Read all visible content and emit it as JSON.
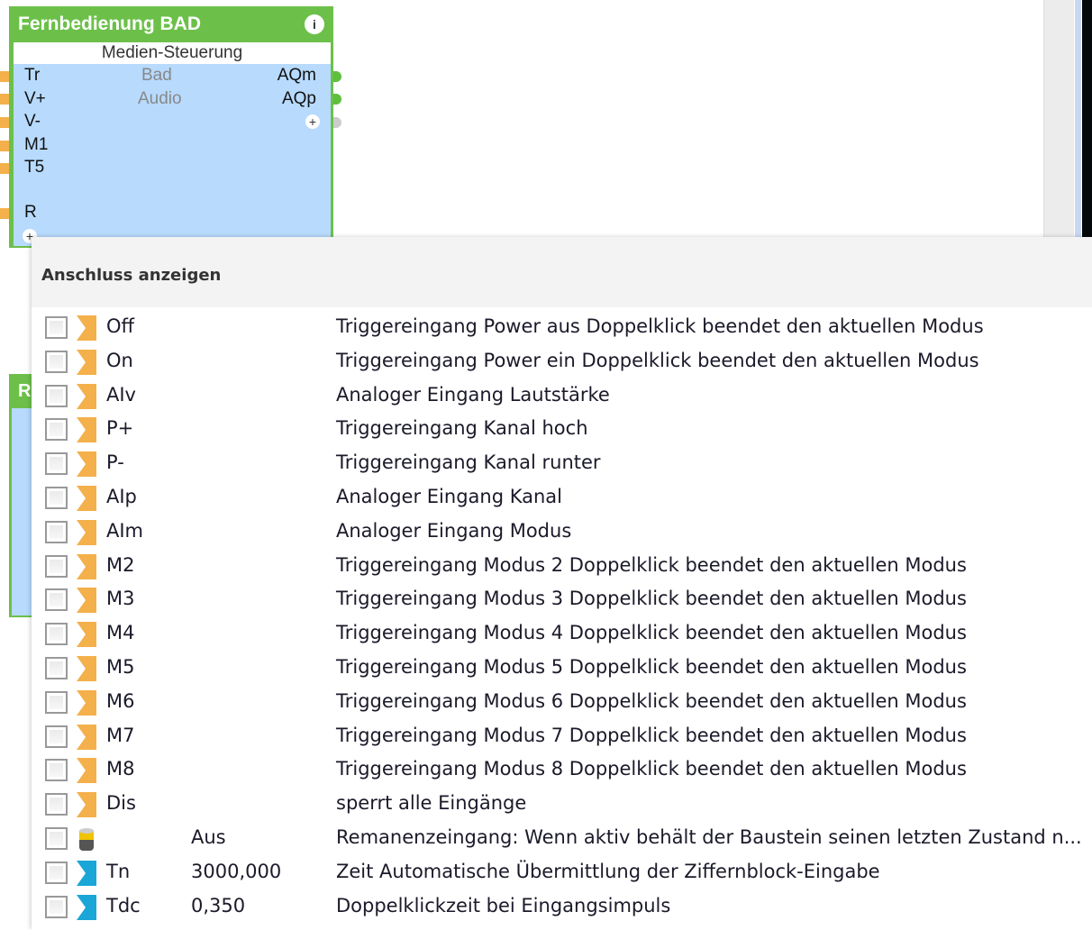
{
  "block": {
    "title": "Fernbedienung BAD",
    "subtitle": "Medien-Steuerung",
    "inputs": [
      "Tr",
      "V+",
      "V-",
      "M1",
      "T5",
      "R"
    ],
    "labels": [
      "Bad",
      "Audio"
    ],
    "outputs": [
      "AQm",
      "AQp"
    ],
    "block2_title": "R"
  },
  "popup": {
    "title": "Anschluss anzeigen",
    "rows": [
      {
        "icon": "trigger-input-icon",
        "name": "Off",
        "value": "",
        "desc": "Triggereingang Power aus Doppelklick beendet den aktuellen Modus"
      },
      {
        "icon": "trigger-input-icon",
        "name": "On",
        "value": "",
        "desc": "Triggereingang Power ein Doppelklick beendet den aktuellen Modus"
      },
      {
        "icon": "trigger-input-icon",
        "name": "AIv",
        "value": "",
        "desc": "Analoger Eingang Lautstärke"
      },
      {
        "icon": "trigger-input-icon",
        "name": "P+",
        "value": "",
        "desc": "Triggereingang Kanal hoch"
      },
      {
        "icon": "trigger-input-icon",
        "name": "P-",
        "value": "",
        "desc": "Triggereingang Kanal runter"
      },
      {
        "icon": "trigger-input-icon",
        "name": "AIp",
        "value": "",
        "desc": "Analoger Eingang Kanal"
      },
      {
        "icon": "trigger-input-icon",
        "name": "AIm",
        "value": "",
        "desc": "Analoger Eingang Modus"
      },
      {
        "icon": "trigger-input-icon",
        "name": "M2",
        "value": "",
        "desc": "Triggereingang Modus 2 Doppelklick beendet den aktuellen Modus"
      },
      {
        "icon": "trigger-input-icon",
        "name": "M3",
        "value": "",
        "desc": "Triggereingang Modus 3 Doppelklick beendet den aktuellen Modus"
      },
      {
        "icon": "trigger-input-icon",
        "name": "M4",
        "value": "",
        "desc": "Triggereingang Modus 4 Doppelklick beendet den aktuellen Modus"
      },
      {
        "icon": "trigger-input-icon",
        "name": "M5",
        "value": "",
        "desc": "Triggereingang Modus 5 Doppelklick beendet den aktuellen Modus"
      },
      {
        "icon": "trigger-input-icon",
        "name": "M6",
        "value": "",
        "desc": "Triggereingang Modus 6 Doppelklick beendet den aktuellen Modus"
      },
      {
        "icon": "trigger-input-icon",
        "name": "M7",
        "value": "",
        "desc": "Triggereingang Modus 7 Doppelklick beendet den aktuellen Modus"
      },
      {
        "icon": "trigger-input-icon",
        "name": "M8",
        "value": "",
        "desc": "Triggereingang Modus 8 Doppelklick beendet den aktuellen Modus"
      },
      {
        "icon": "trigger-input-icon",
        "name": "Dis",
        "value": "",
        "desc": "sperrt alle Eingänge"
      },
      {
        "icon": "battery-icon",
        "name": "",
        "value": "Aus",
        "desc": "Remanenzeingang: Wenn aktiv behält der Baustein seinen letzten Zustand n..."
      },
      {
        "icon": "parameter-input-icon",
        "name": "Tn",
        "value": "3000,000",
        "desc": "Zeit Automatische Übermittlung der Ziffernblock-Eingabe"
      },
      {
        "icon": "parameter-input-icon",
        "name": "Tdc",
        "value": "0,350",
        "desc": "Doppelklickzeit bei Eingangsimpuls"
      }
    ]
  },
  "colors": {
    "block_header": "#6cc04a",
    "block_body": "#b7dafd",
    "trigger": "#f4b04a",
    "parameter": "#1aa6d6"
  }
}
